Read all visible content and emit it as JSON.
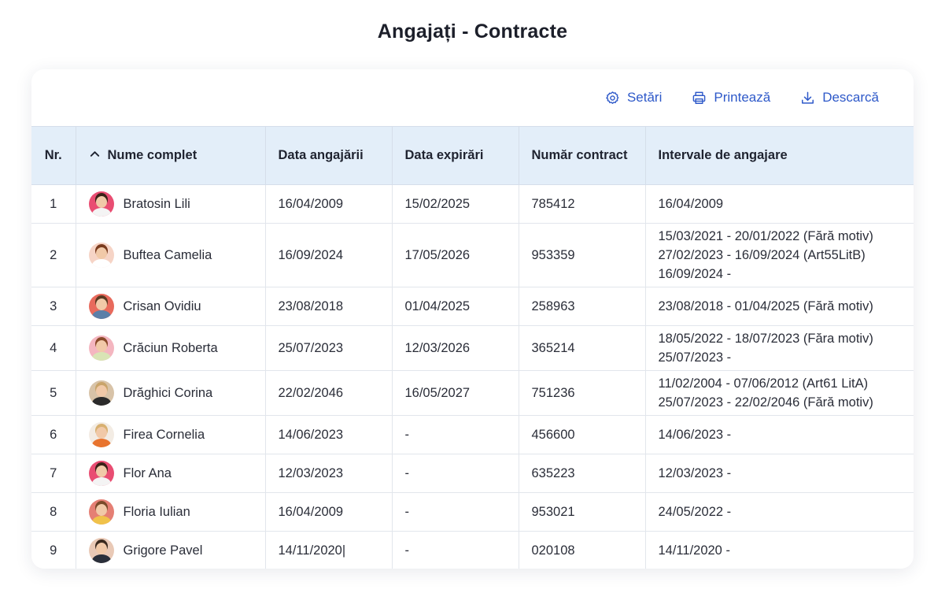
{
  "title": "Angajați - Contracte",
  "toolbar": {
    "settings_label": "Setări",
    "print_label": "Printează",
    "download_label": "Descarcă"
  },
  "table": {
    "headers": {
      "nr": "Nr.",
      "name": "Nume complet",
      "hire_date": "Data angajării",
      "expiry_date": "Data expirări",
      "contract_number": "Număr contract",
      "intervals": "Intervale de angajare"
    },
    "sort": {
      "column": "name",
      "direction": "ascending"
    },
    "rows": [
      {
        "nr": "1",
        "name": "Bratosin Lili",
        "hire": "16/04/2009",
        "expiry": "15/02/2025",
        "contract": "785412",
        "intervals": [
          "16/04/2009"
        ],
        "avatar": {
          "bg": "#e94d72",
          "shirt": "#f4f4f4",
          "hair": "#3a2218"
        }
      },
      {
        "nr": "2",
        "name": "Buftea Camelia",
        "hire": "16/09/2024",
        "expiry": "17/05/2026",
        "contract": "953359",
        "intervals": [
          "15/03/2021 - 20/01/2022 (Fără motiv)",
          "27/02/2023 - 16/09/2024 (Art55LitB)",
          "16/09/2024 -"
        ],
        "avatar": {
          "bg": "#f6d4c6",
          "shirt": "#ffffff",
          "hair": "#7a3b1e"
        }
      },
      {
        "nr": "3",
        "name": "Crisan Ovidiu",
        "hire": "23/08/2018",
        "expiry": "01/04/2025",
        "contract": "258963",
        "intervals": [
          "23/08/2018 - 01/04/2025 (Fără motiv)"
        ],
        "avatar": {
          "bg": "#e86a5c",
          "shirt": "#5b7fa8",
          "hair": "#5a3a22"
        }
      },
      {
        "nr": "4",
        "name": "Crăciun Roberta",
        "hire": "25/07/2023",
        "expiry": "12/03/2026",
        "contract": "365214",
        "intervals": [
          "18/05/2022 - 18/07/2023 (Făra motiv)",
          "25/07/2023 -"
        ],
        "avatar": {
          "bg": "#f4b6c0",
          "shirt": "#d9e4b5",
          "hair": "#8a4a2a"
        }
      },
      {
        "nr": "5",
        "name": "Drăghici Corina",
        "hire": "22/02/2046",
        "expiry": "16/05/2027",
        "contract": "751236",
        "intervals": [
          "11/02/2004 - 07/06/2012 (Art61 LitA)",
          "25/07/2023 - 22/02/2046 (Fără motiv)"
        ],
        "avatar": {
          "bg": "#d8c3a8",
          "shirt": "#2b2b2b",
          "hair": "#c9a46a"
        }
      },
      {
        "nr": "6",
        "name": "Firea Cornelia",
        "hire": "14/06/2023",
        "expiry": "-",
        "contract": "456600",
        "intervals": [
          "14/06/2023 -"
        ],
        "avatar": {
          "bg": "#f3ece4",
          "shirt": "#e8742e",
          "hair": "#d8b070"
        }
      },
      {
        "nr": "7",
        "name": "Flor Ana",
        "hire": "12/03/2023",
        "expiry": "-",
        "contract": "635223",
        "intervals": [
          "12/03/2023 -"
        ],
        "avatar": {
          "bg": "#e94d72",
          "shirt": "#f4f4f4",
          "hair": "#3a2218"
        }
      },
      {
        "nr": "8",
        "name": "Floria Iulian",
        "hire": "16/04/2009",
        "expiry": "-",
        "contract": "953021",
        "intervals": [
          "24/05/2022 -"
        ],
        "avatar": {
          "bg": "#e57f74",
          "shirt": "#f0c24a",
          "hair": "#7a4a2a"
        }
      },
      {
        "nr": "9",
        "name": "Grigore Pavel",
        "hire": "14/11/2020|",
        "expiry": "-",
        "contract": "020108",
        "intervals": [
          "14/11/2020 -"
        ],
        "avatar": {
          "bg": "#e9c9b6",
          "shirt": "#2a2f3a",
          "hair": "#3b2a1f"
        }
      }
    ]
  },
  "colors": {
    "accent": "#2e59c9",
    "header_bg": "#e3eef9",
    "grid": "#e2e6ec"
  }
}
